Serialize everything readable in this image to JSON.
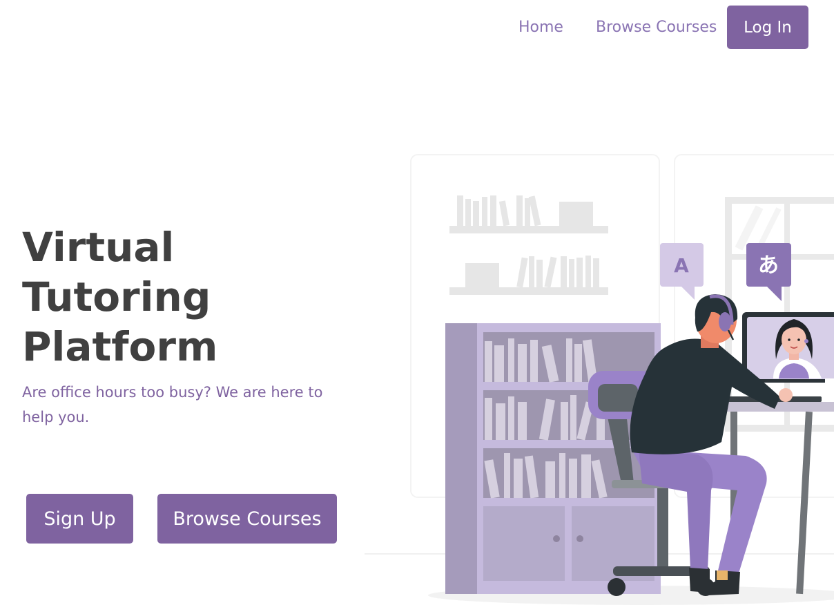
{
  "nav": {
    "home_label": "Home",
    "browse_label": "Browse Courses",
    "login_label": "Log In"
  },
  "hero": {
    "title_lines": [
      "Virtual",
      "Tutoring",
      "Platform"
    ],
    "subtitle": "Are office hours too busy? We are here to help you.",
    "signup_label": "Sign Up",
    "browse_label": "Browse Courses"
  },
  "illustration": {
    "bubble_left_char": "A",
    "bubble_right_char": "あ"
  },
  "colors": {
    "accent": "#7f63a0",
    "nav_link": "#8a74b3",
    "heading": "#404040",
    "background": "#ffffff"
  }
}
